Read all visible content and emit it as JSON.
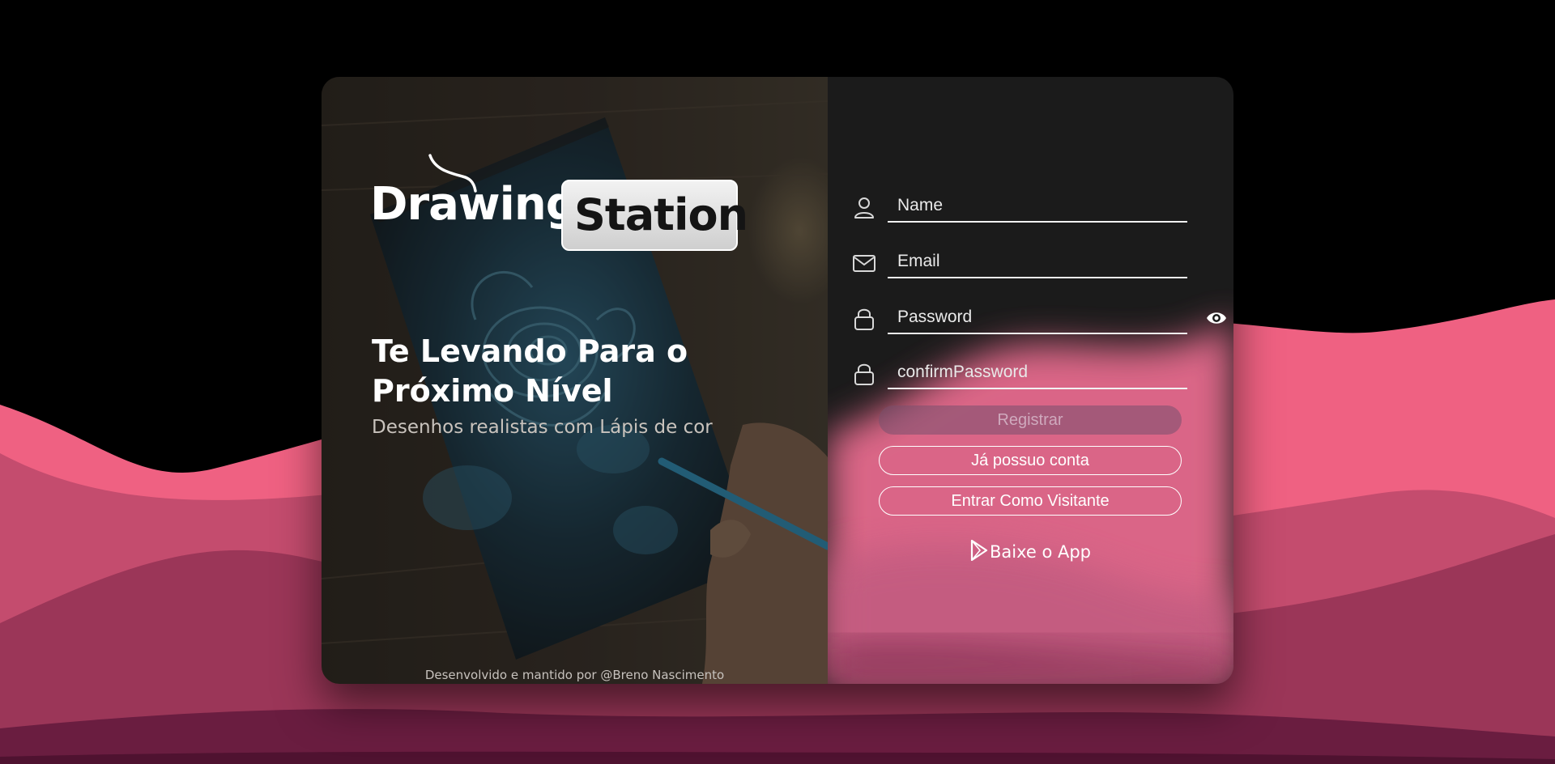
{
  "colors": {
    "background": "#000000",
    "wave_light": "#ef6182",
    "wave_mid": "#c44c6e",
    "wave_dark": "#9b3658",
    "wave_deepest": "#4f1230",
    "panel_dark": "#1b1b1b",
    "text_light": "#ffffff"
  },
  "brand": {
    "logo_word_1": "Drawing",
    "logo_word_2": "Station"
  },
  "hero": {
    "headline": "Te Levando Para o Próximo Nível",
    "subline": "Desenhos realistas com Lápis de cor",
    "credits": "Desenvolvido e mantido por @Breno Nascimento",
    "image_subject": "hand-drawing-blue-rose-photo"
  },
  "form": {
    "name_placeholder": "Name",
    "email_placeholder": "Email",
    "password_placeholder": "Password",
    "confirm_placeholder": "confirmPassword",
    "register_label": "Registrar",
    "have_account_label": "Já possuo conta",
    "guest_label": "Entrar Como Visitante",
    "app_link_label": "Baixe o App",
    "icons": {
      "name": "user-icon",
      "email": "mail-icon",
      "password": "lock-icon",
      "confirm": "lock-icon",
      "show_password": "eye-icon",
      "app": "play-store-icon"
    }
  }
}
